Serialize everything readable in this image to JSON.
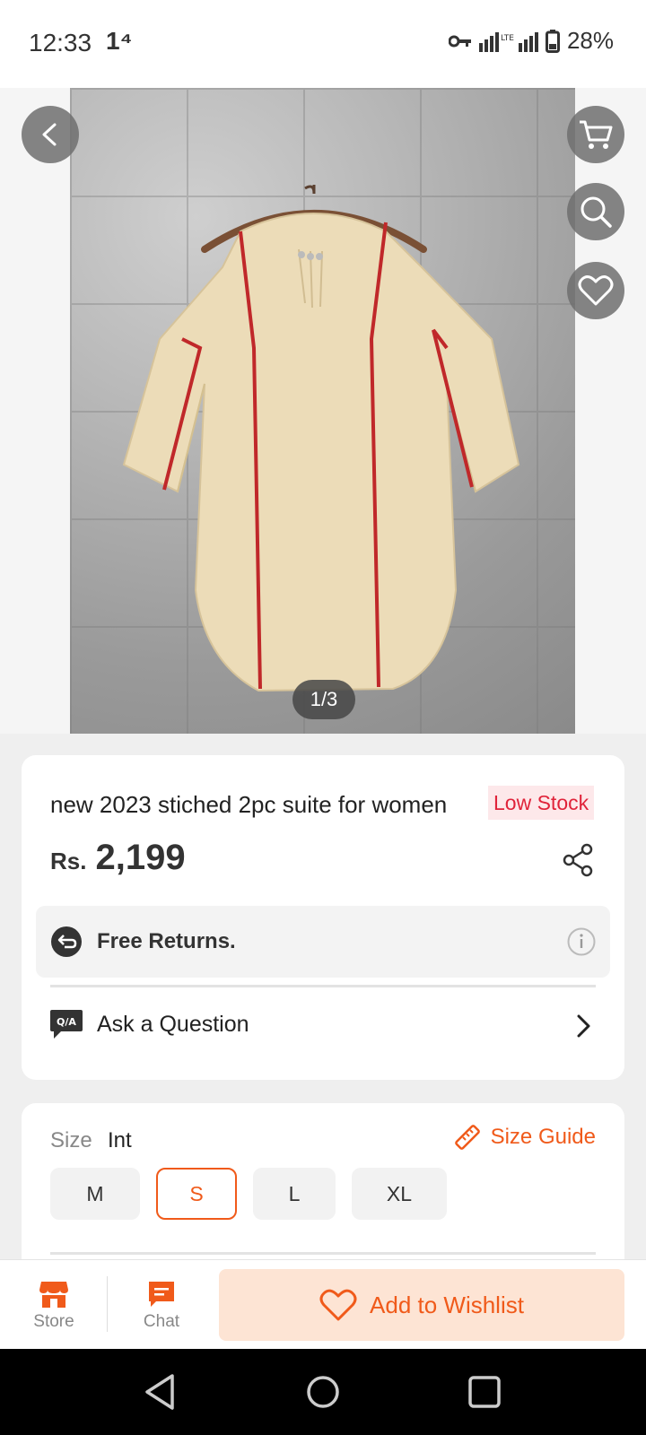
{
  "status": {
    "time": "12:33",
    "sub_indicator": "1⁴",
    "battery": "28%"
  },
  "gallery": {
    "page_indicator": "1/3"
  },
  "product": {
    "title": "new 2023 stiched 2pc suite for women",
    "stock_badge": "Low Stock",
    "currency": "Rs.",
    "price": "2,199",
    "returns_label": "Free Returns.",
    "ask_label": "Ask a Question"
  },
  "size": {
    "label": "Size",
    "system": "Int",
    "guide_label": "Size Guide",
    "options": [
      "M",
      "S",
      "L",
      "XL"
    ],
    "selected": "S"
  },
  "bottom_bar": {
    "store_label": "Store",
    "chat_label": "Chat",
    "wishlist_label": "Add to Wishlist"
  },
  "colors": {
    "accent": "#f05a1a",
    "low_stock": "#e0233a"
  },
  "icons": [
    "back-arrow-icon",
    "cart-icon",
    "search-icon",
    "heart-icon",
    "share-icon",
    "return-icon",
    "info-icon",
    "qa-icon",
    "chevron-right-icon",
    "ruler-icon",
    "store-icon",
    "chat-icon"
  ]
}
